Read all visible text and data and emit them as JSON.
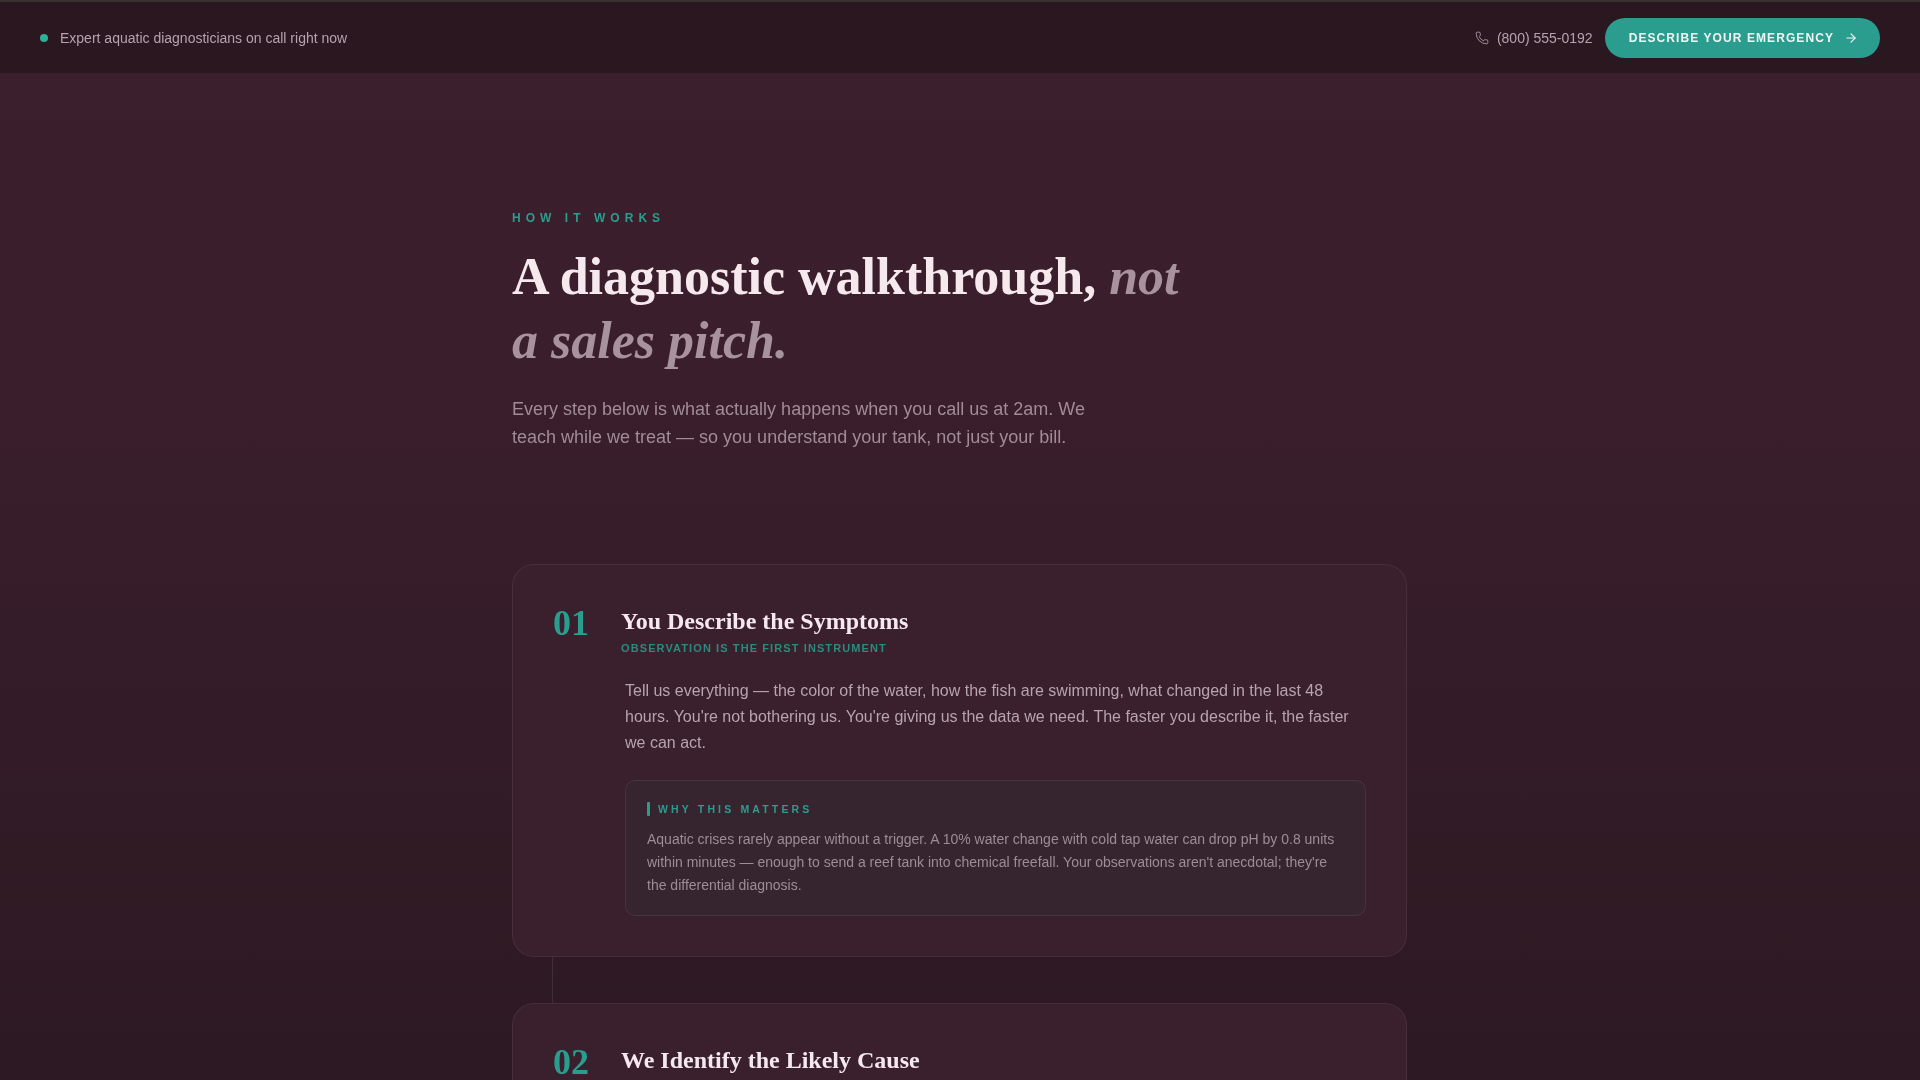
{
  "top_bar": {
    "status_text": "Expert aquatic diagnosticians on call right now",
    "phone": "(800) 555-0192",
    "cta_button": "DESCRIBE YOUR EMERGENCY"
  },
  "section": {
    "eyebrow": "HOW IT WORKS",
    "heading": "A diagnostic walkthrough, *not a sales pitch.*",
    "intro": "Every step below is what actually happens when you call us at 2am. We teach while we treat — so you understand your tank, not just your bill."
  },
  "steps": [
    {
      "number": "01",
      "title": "You Describe the Symptoms",
      "subtitle": "OBSERVATION IS THE FIRST INSTRUMENT",
      "body": "Tell us everything — the color of the water, how the fish are swimming, what changed in the last 48 hours. You're not bothering us. You're giving us the data we need. The faster you describe it, the faster we can act.",
      "note": {
        "label": "WHY THIS MATTERS",
        "text": "Aquatic crises rarely appear without a trigger. A 10% water change with cold tap water can drop pH by 0.8 units within minutes — enough to send a reef tank into chemical freefall. Your observations aren't anecdotal; they're the differential diagnosis."
      }
    },
    {
      "number": "02",
      "title": "We Identify the Likely Cause"
    }
  ]
}
